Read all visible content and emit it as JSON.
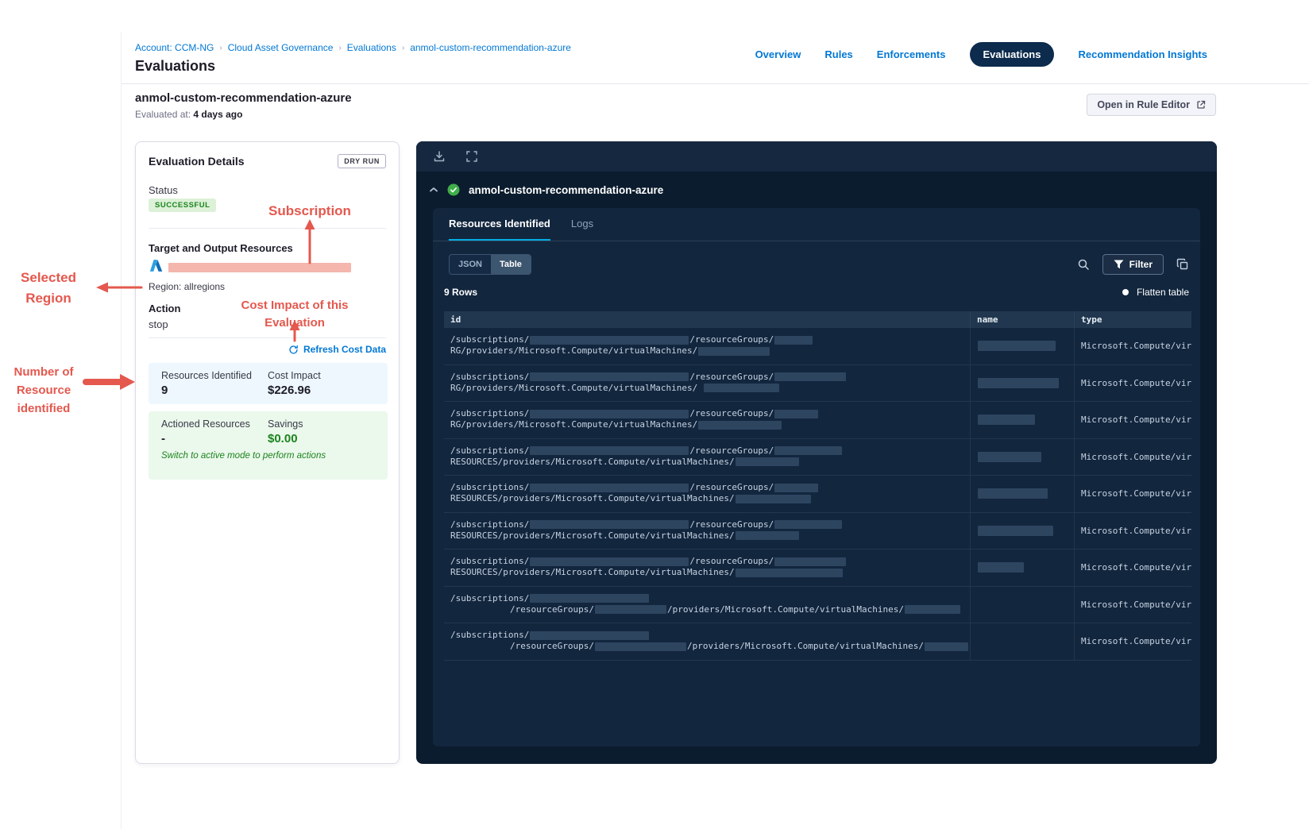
{
  "colors": {
    "link_blue": "#0278D5",
    "annotation_red": "#E4584E",
    "success_green": "#1B841D",
    "panel_navy": "#0B1C2E",
    "tab_underline_blue": "#00ADE4",
    "redacted_pink": "#F4B6AD",
    "redacted_slate": "#2E4560"
  },
  "breadcrumb": {
    "items": [
      "Account: CCM-NG",
      "Cloud Asset Governance",
      "Evaluations",
      "anmol-custom-recommendation-azure"
    ],
    "separator": "›"
  },
  "header": {
    "title": "Evaluations",
    "nav": [
      {
        "label": "Overview",
        "active": false
      },
      {
        "label": "Rules",
        "active": false
      },
      {
        "label": "Enforcements",
        "active": false
      },
      {
        "label": "Evaluations",
        "active": true
      },
      {
        "label": "Recommendation Insights",
        "active": false
      }
    ]
  },
  "subheader": {
    "name": "anmol-custom-recommendation-azure",
    "evaluated_label": "Evaluated at:",
    "evaluated_value": "4 days ago",
    "open_rule_editor_label": "Open in Rule Editor"
  },
  "evaluation_details": {
    "title": "Evaluation Details",
    "dry_run_badge": "DRY RUN",
    "status_label": "Status",
    "status_value": "SUCCESSFUL",
    "target_label": "Target and Output Resources",
    "region": "Region: allregions",
    "action_label": "Action",
    "action_value": "stop",
    "refresh_cost_label": "Refresh Cost Data",
    "summary": {
      "resources_identified_label": "Resources Identified",
      "resources_identified_value": "9",
      "cost_impact_label": "Cost Impact",
      "cost_impact_value": "$226.96",
      "actioned_resources_label": "Actioned Resources",
      "actioned_resources_value": "-",
      "savings_label": "Savings",
      "savings_value": "$0.00",
      "active_mode_note": "Switch to active mode to perform actions"
    }
  },
  "results_panel": {
    "title": "anmol-custom-recommendation-azure",
    "tabs": [
      {
        "label": "Resources Identified",
        "active": true
      },
      {
        "label": "Logs",
        "active": false
      }
    ],
    "view_toggle": [
      {
        "label": "JSON",
        "active": false
      },
      {
        "label": "Table",
        "active": true
      }
    ],
    "filter_label": "Filter",
    "rows_count": "9 Rows",
    "flatten_label": "Flatten table",
    "table": {
      "columns": [
        "id",
        "name",
        "type"
      ],
      "rows": [
        {
          "id": [
            [
              {
                "t": "/subscriptions/"
              },
              {
                "r": 200
              },
              {
                "t": "/resourceGroups/"
              },
              {
                "r": 48
              }
            ],
            [
              {
                "t": "RG/providers/Microsoft.Compute/virtualMachines/"
              },
              {
                "r": 90
              }
            ]
          ],
          "name_r": 98,
          "type": "Microsoft.Compute/virtu"
        },
        {
          "id": [
            [
              {
                "t": "/subscriptions/"
              },
              {
                "r": 200
              },
              {
                "t": "/resourceGroups/"
              },
              {
                "r": 90
              }
            ],
            [
              {
                "t": "RG/providers/Microsoft.Compute/virtualMachines/ "
              },
              {
                "r": 95
              }
            ]
          ],
          "name_r": 102,
          "type": "Microsoft.Compute/virtu"
        },
        {
          "id": [
            [
              {
                "t": "/subscriptions/"
              },
              {
                "r": 200
              },
              {
                "t": "/resourceGroups/"
              },
              {
                "r": 55
              }
            ],
            [
              {
                "t": "RG/providers/Microsoft.Compute/virtualMachines/"
              },
              {
                "r": 105
              }
            ]
          ],
          "name_r": 72,
          "type": "Microsoft.Compute/virtu"
        },
        {
          "id": [
            [
              {
                "t": "/subscriptions/"
              },
              {
                "r": 200
              },
              {
                "t": "/resourceGroups/"
              },
              {
                "r": 85
              }
            ],
            [
              {
                "t": "RESOURCES/providers/Microsoft.Compute/virtualMachines/"
              },
              {
                "r": 80
              }
            ]
          ],
          "name_r": 80,
          "type": "Microsoft.Compute/virtu"
        },
        {
          "id": [
            [
              {
                "t": "/subscriptions/"
              },
              {
                "r": 200
              },
              {
                "t": "/resourceGroups/"
              },
              {
                "r": 55
              }
            ],
            [
              {
                "t": "RESOURCES/providers/Microsoft.Compute/virtualMachines/"
              },
              {
                "r": 95
              }
            ]
          ],
          "name_r": 88,
          "type": "Microsoft.Compute/virtu"
        },
        {
          "id": [
            [
              {
                "t": "/subscriptions/"
              },
              {
                "r": 200
              },
              {
                "t": "/resourceGroups/"
              },
              {
                "r": 85
              }
            ],
            [
              {
                "t": "RESOURCES/providers/Microsoft.Compute/virtualMachines/"
              },
              {
                "r": 80
              }
            ]
          ],
          "name_r": 95,
          "type": "Microsoft.Compute/virtu"
        },
        {
          "id": [
            [
              {
                "t": "/subscriptions/"
              },
              {
                "r": 200
              },
              {
                "t": "/resourceGroups/"
              },
              {
                "r": 90
              }
            ],
            [
              {
                "t": "RESOURCES/providers/Microsoft.Compute/virtualMachines/"
              },
              {
                "r": 135
              }
            ]
          ],
          "name_r": 58,
          "type": "Microsoft.Compute/virtu"
        },
        {
          "id": [
            [
              {
                "t": "/subscriptions/"
              },
              {
                "r": 150
              }
            ],
            [
              {
                "sp": 75
              },
              {
                "t": "/resourceGroups/"
              },
              {
                "r": 90
              },
              {
                "t": "/providers/Microsoft.Compute/virtualMachines/"
              },
              {
                "r": 70
              }
            ]
          ],
          "name_r": 0,
          "type": "Microsoft.Compute/virtu"
        },
        {
          "id": [
            [
              {
                "t": "/subscriptions/"
              },
              {
                "r": 150
              }
            ],
            [
              {
                "sp": 75
              },
              {
                "t": "/resourceGroups/"
              },
              {
                "r": 115
              },
              {
                "t": "/providers/Microsoft.Compute/virtualMachines/"
              },
              {
                "r": 55
              }
            ]
          ],
          "name_r": 0,
          "type": "Microsoft.Compute/virtu"
        }
      ]
    }
  },
  "annotations": {
    "subscription": "Subscription",
    "selected_region": "Selected Region",
    "cost_impact": "Cost Impact of this Evaluation",
    "resources_identified": "Number of Resource identified"
  }
}
